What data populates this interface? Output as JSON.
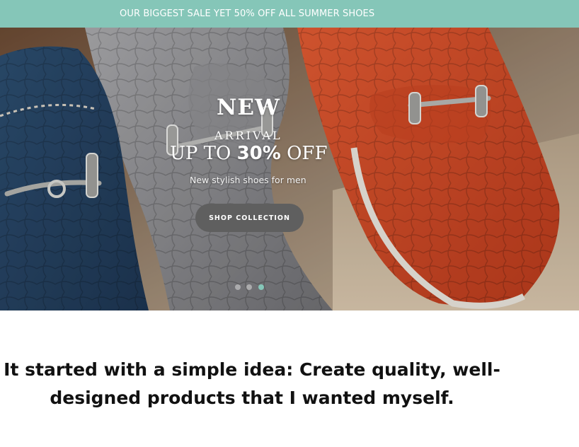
{
  "announcement": {
    "text": "OUR BIGGEST SALE YET 50% OFF ALL SUMMER SHOES"
  },
  "hero": {
    "title_line1": "NEW",
    "title_line2": "ARRIVAL",
    "offer_prefix": "UP TO ",
    "offer_value": "30%",
    "offer_suffix": " OFF",
    "subtitle": "New stylish shoes for men",
    "button_label": "SHOP COLLECTION",
    "slides": [
      {
        "active": false
      },
      {
        "active": false
      },
      {
        "active": true
      }
    ],
    "image_alt": "photo of blue, grey and orange crocodile-texture loafers with metal bits"
  },
  "intro": {
    "headline": "It started with a simple idea: Create quality, well-designed products that I wanted myself."
  },
  "colors": {
    "announcement_bg": "#85c6b8",
    "button_bg": "#5f5f5f",
    "active_dot": "#85c6b8"
  }
}
